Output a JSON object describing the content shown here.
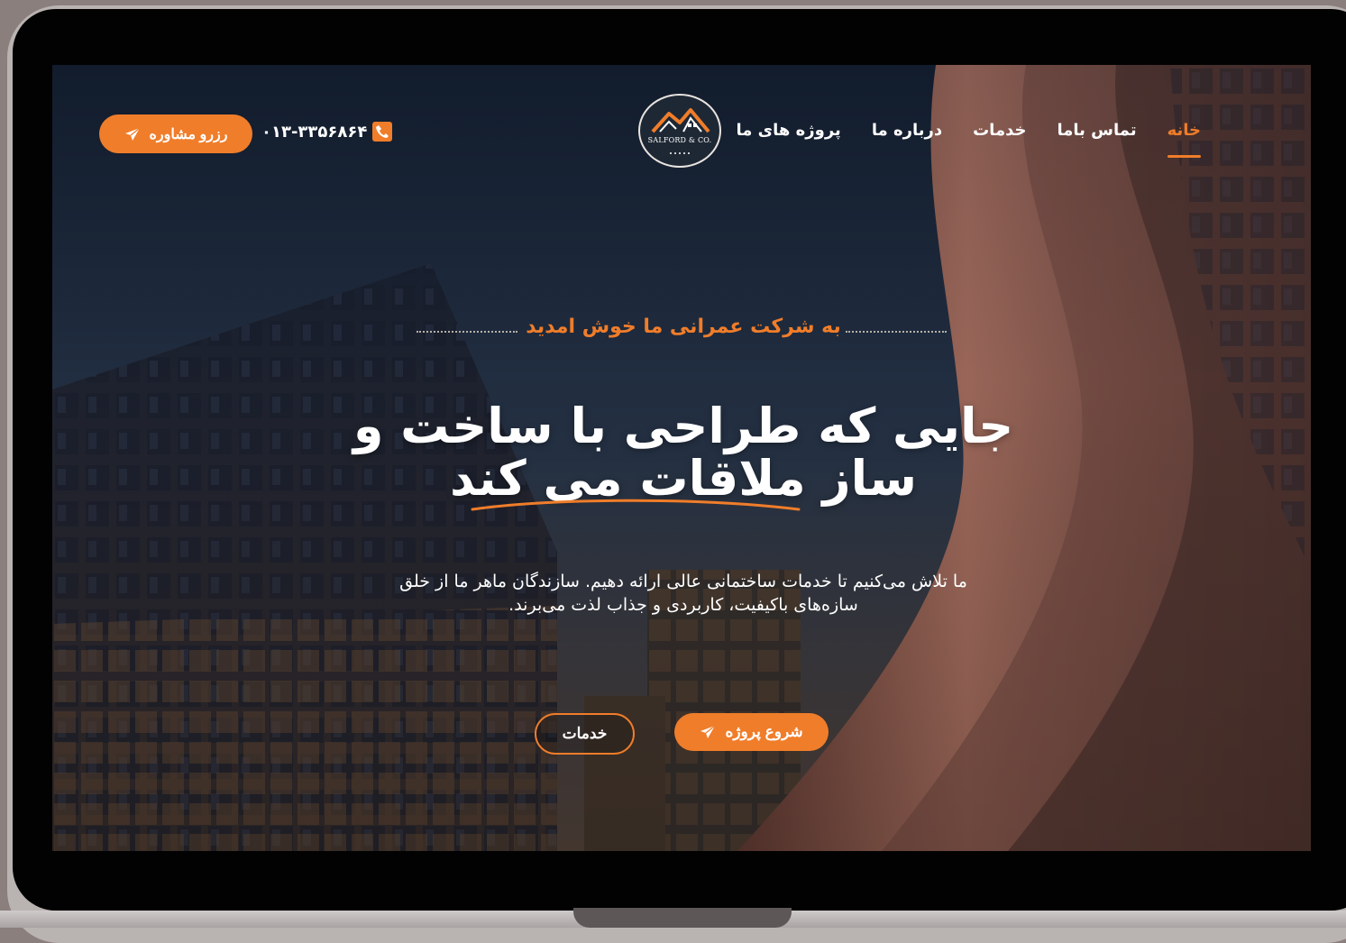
{
  "nav": {
    "items": [
      {
        "label": "خانه",
        "active": true
      },
      {
        "label": "تماس باما",
        "active": false
      },
      {
        "label": "خدمات",
        "active": false
      },
      {
        "label": "درباره ما",
        "active": false
      },
      {
        "label": "پروژه های ما",
        "active": false
      }
    ]
  },
  "logo": {
    "text": "SALFORD & CO."
  },
  "contact": {
    "phone": "۰۱۳-۳۳۵۶۸۶۴",
    "icon": "phone-icon"
  },
  "header": {
    "consult_label": "رزرو مشاوره",
    "consult_icon": "paper-plane-icon"
  },
  "hero": {
    "eyebrow": "به شرکت عمرانی ما خوش امدید",
    "headline_line1": "جایی که طراحی با ساخت و",
    "headline_line2": "ساز ملاقات می کند",
    "description_line1": "ما تلاش می‌کنیم تا خدمات ساختمانی عالی ارائه دهیم. سازندگان ماهر ما از خلق",
    "description_line2": "سازه‌های باکیفیت، کاربردی و جذاب لذت می‌برند.",
    "start_label": "شروع پروژه",
    "services_label": "خدمات"
  },
  "colors": {
    "accent": "#f07d2a",
    "text": "#ffffff"
  }
}
